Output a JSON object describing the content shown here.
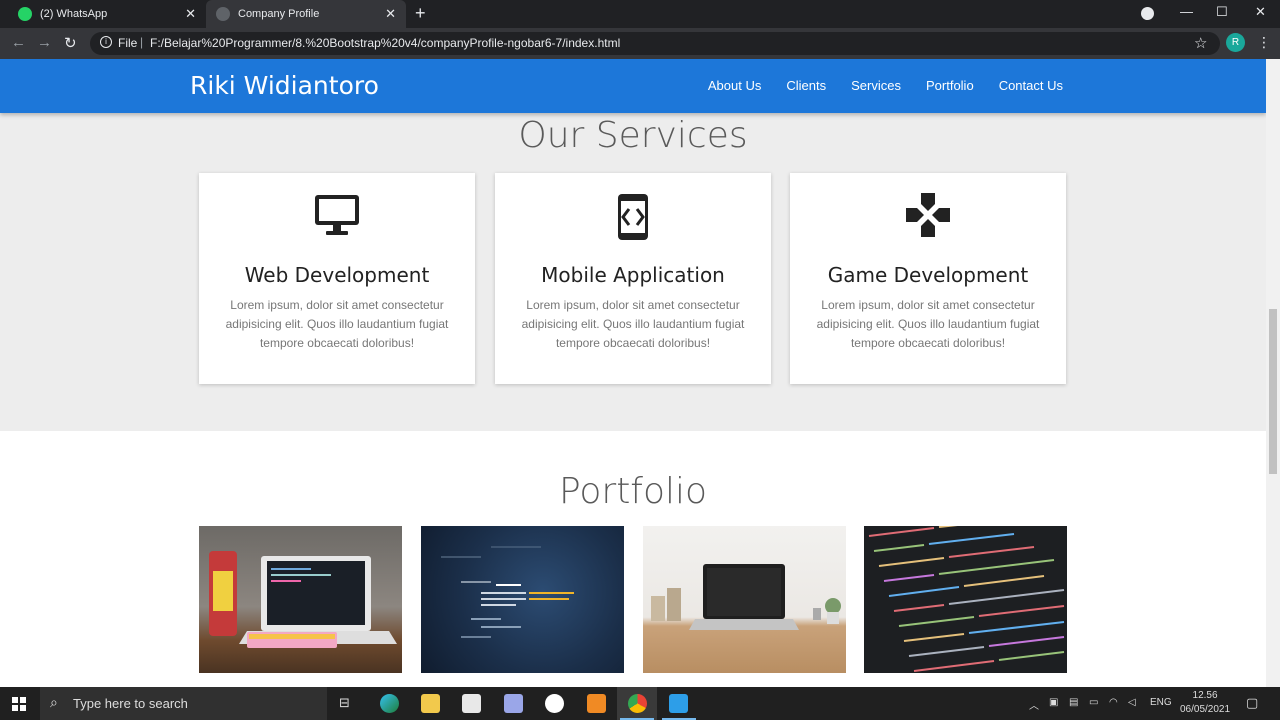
{
  "browser": {
    "tabs": [
      {
        "title": "(2) WhatsApp",
        "active": false
      },
      {
        "title": "Company Profile",
        "active": true
      }
    ],
    "address": {
      "scheme_label": "File",
      "url": "F:/Belajar%20Programmer/8.%20Bootstrap%20v4/companyProfile-ngobar6-7/index.html"
    },
    "profile_initial": "R"
  },
  "site": {
    "brand": "Riki Widiantoro",
    "menu": [
      "About Us",
      "Clients",
      "Services",
      "Portfolio",
      "Contact Us"
    ],
    "services": {
      "title": "Our Services",
      "cards": [
        {
          "icon": "desktop-icon",
          "title": "Web Development",
          "text": "Lorem ipsum, dolor sit amet consectetur adipisicing elit. Quos illo laudantium fugiat tempore obcaecati doloribus!"
        },
        {
          "icon": "mobile-code-icon",
          "title": "Mobile Application",
          "text": "Lorem ipsum, dolor sit amet consectetur adipisicing elit. Quos illo laudantium fugiat tempore obcaecati doloribus!"
        },
        {
          "icon": "gamepad-icon",
          "title": "Game Development",
          "text": "Lorem ipsum, dolor sit amet consectetur adipisicing elit. Quos illo laudantium fugiat tempore obcaecati doloribus!"
        }
      ]
    },
    "portfolio": {
      "title": "Portfolio"
    }
  },
  "taskbar": {
    "search_placeholder": "Type here to search",
    "language": "ENG",
    "time": "12.56",
    "date": "06/05/2021"
  }
}
